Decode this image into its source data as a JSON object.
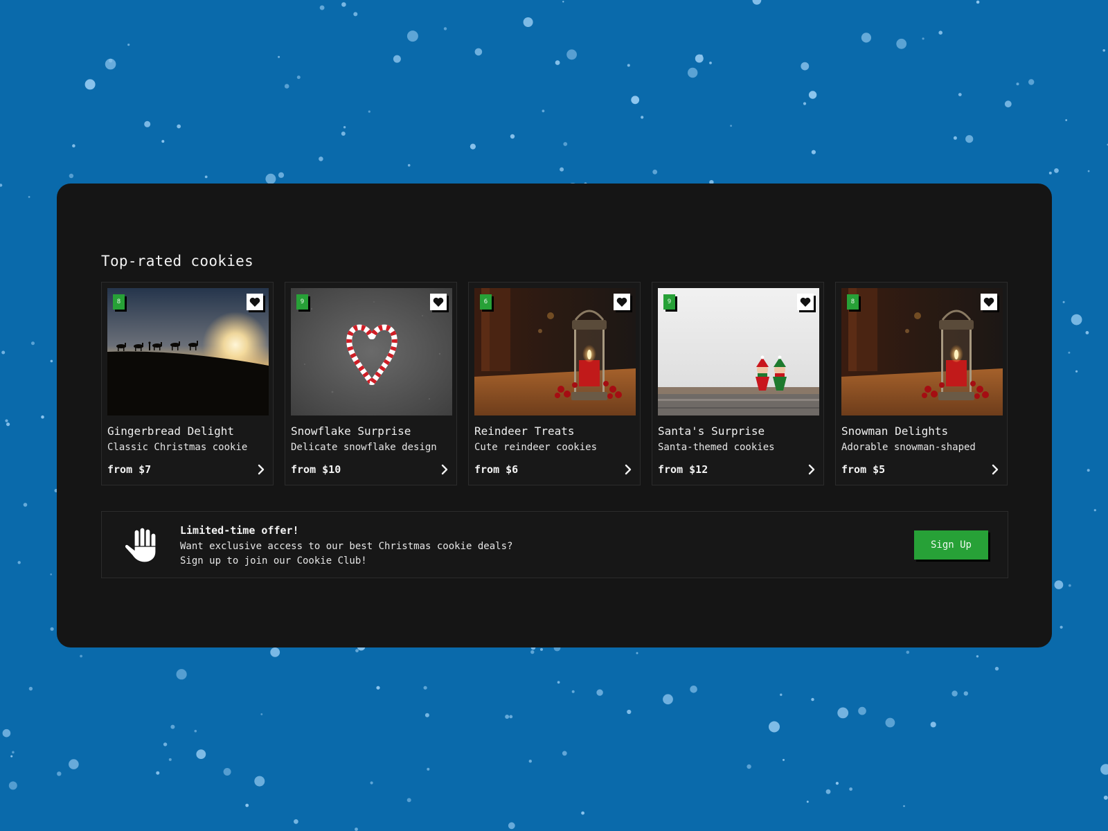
{
  "background": {
    "color": "#0a6aab",
    "snow_color": "#8ec6ee"
  },
  "section": {
    "title": "Top-rated cookies"
  },
  "cards": [
    {
      "badge": "8",
      "name": "Gingerbread Delight",
      "description": "Classic Christmas cookie",
      "price": "from $7",
      "image": "desert-camels-sunset"
    },
    {
      "badge": "9",
      "name": "Snowflake Surprise",
      "description": "Delicate snowflake design",
      "price": "from $10",
      "image": "candy-cane-heart"
    },
    {
      "badge": "6",
      "name": "Reindeer Treats",
      "description": "Cute reindeer cookies",
      "price": "from $6",
      "image": "candle-lantern"
    },
    {
      "badge": "9",
      "name": "Santa's Surprise",
      "description": "Santa-themed cookies",
      "price": "from $12",
      "image": "elves-on-shelf"
    },
    {
      "badge": "8",
      "name": "Snowman Delights",
      "description": "Adorable snowman-shaped",
      "price": "from $5",
      "image": "candle-lantern"
    }
  ],
  "offer": {
    "title": "Limited-time offer!",
    "line1": "Want exclusive access to our best Christmas cookie deals?",
    "line2": "Sign up to join our Cookie Club!",
    "button_label": "Sign Up",
    "icon": "raised-hand-icon"
  },
  "colors": {
    "panel": "#151515",
    "accent": "#27a137",
    "text": "#f0f0f0"
  }
}
